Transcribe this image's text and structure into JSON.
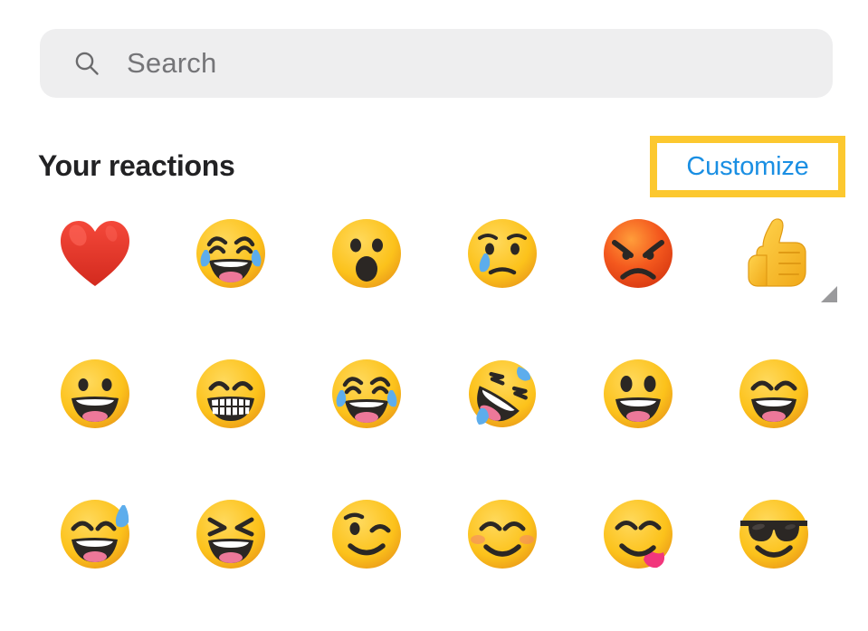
{
  "search": {
    "icon": "search-icon",
    "placeholder": "Search",
    "value": ""
  },
  "section": {
    "title": "Your reactions",
    "customize_label": "Customize",
    "customize_highlight_color": "#fcc82f",
    "customize_link_color": "#1a8fe3"
  },
  "colors": {
    "page_background": "#ffffff",
    "search_background": "#eeeeef",
    "title_text": "#222224",
    "placeholder_text": "#757578",
    "emoji_yellow": "#fcc21b",
    "emoji_yellow_dark": "#f5a623",
    "heart_red": "#ea3323",
    "angry_orange": "#f4511e",
    "tear_blue": "#5dadec",
    "tongue_pink": "#f2367c",
    "mouth_dark": "#2b2724",
    "variant_triangle": "#9a9a9c"
  },
  "emoji_grid": {
    "columns": 6,
    "rows": [
      [
        {
          "name": "red-heart",
          "label": "Red heart"
        },
        {
          "name": "face-with-tears-of-joy",
          "label": "Face with tears of joy"
        },
        {
          "name": "face-with-open-mouth",
          "label": "Face with open mouth"
        },
        {
          "name": "crying-face",
          "label": "Crying face"
        },
        {
          "name": "pouting-face",
          "label": "Pouting face"
        },
        {
          "name": "thumbs-up",
          "label": "Thumbs up",
          "has_variant_indicator": true
        }
      ],
      [
        {
          "name": "grinning-face",
          "label": "Grinning face"
        },
        {
          "name": "beaming-face-with-smiling-eyes",
          "label": "Beaming face with smiling eyes"
        },
        {
          "name": "face-with-tears-of-joy",
          "label": "Face with tears of joy"
        },
        {
          "name": "rolling-on-the-floor-laughing",
          "label": "Rolling on the floor laughing"
        },
        {
          "name": "grinning-face-with-big-eyes",
          "label": "Grinning face with big eyes"
        },
        {
          "name": "grinning-face-with-smiling-eyes",
          "label": "Grinning face with smiling eyes"
        }
      ],
      [
        {
          "name": "grinning-face-with-sweat",
          "label": "Grinning face with sweat"
        },
        {
          "name": "grinning-squinting-face",
          "label": "Grinning squinting face"
        },
        {
          "name": "winking-face",
          "label": "Winking face"
        },
        {
          "name": "smiling-face-with-smiling-eyes",
          "label": "Smiling face with smiling eyes"
        },
        {
          "name": "face-savoring-food",
          "label": "Face savoring food"
        },
        {
          "name": "smiling-face-with-sunglasses",
          "label": "Smiling face with sunglasses"
        }
      ]
    ]
  }
}
